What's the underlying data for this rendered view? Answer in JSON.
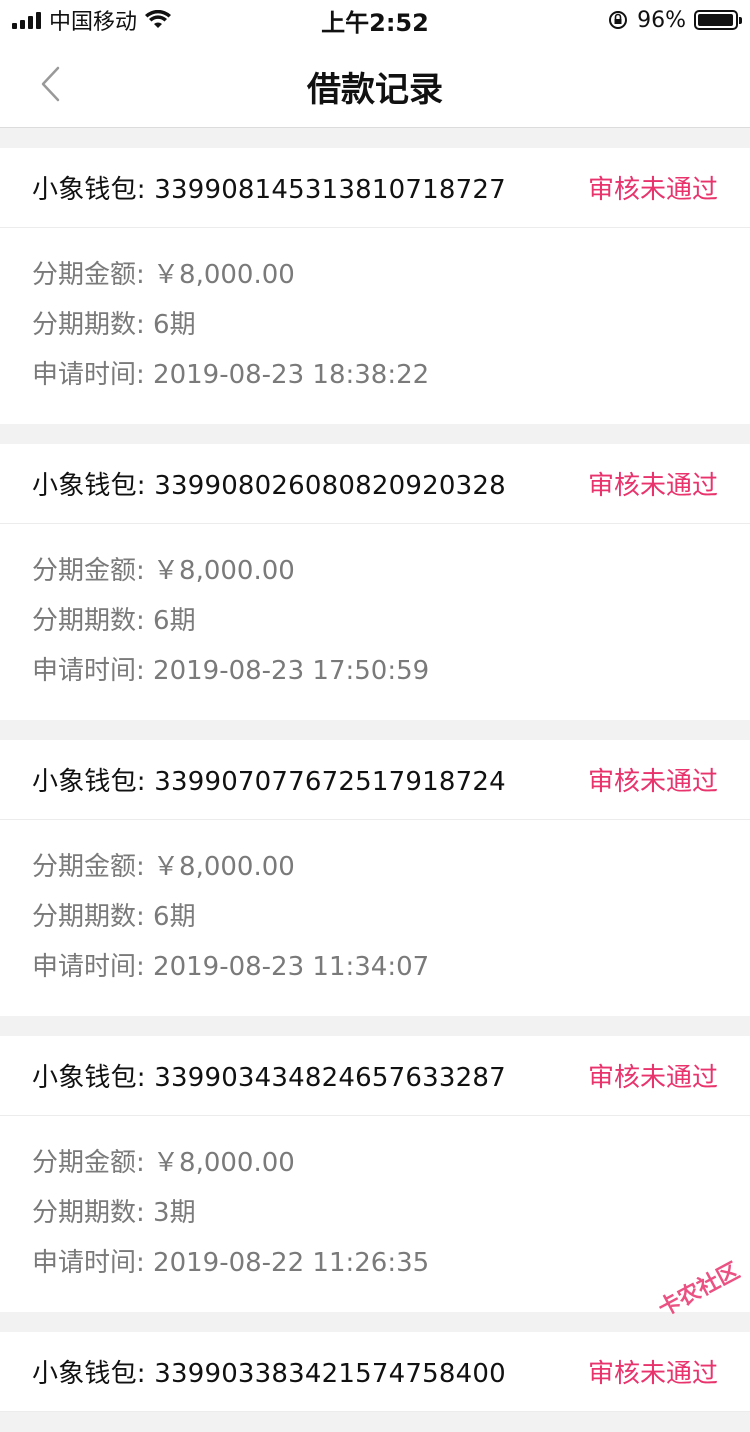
{
  "status_bar": {
    "carrier": "中国移动",
    "time": "上午2:52",
    "battery": "96%",
    "battery_level": 0.96
  },
  "nav": {
    "title": "借款记录",
    "back_icon": "chevron-left-icon"
  },
  "labels": {
    "amount": "分期金额: ",
    "periods": "分期期数: ",
    "applied": "申请时间: "
  },
  "records": [
    {
      "name": "小象钱包: 339908145313810718727",
      "status": "审核未通过",
      "amount": "￥8,000.00",
      "periods": "6期",
      "time": "2019-08-23 18:38:22"
    },
    {
      "name": "小象钱包: 339908026080820920328",
      "status": "审核未通过",
      "amount": "￥8,000.00",
      "periods": "6期",
      "time": "2019-08-23 17:50:59"
    },
    {
      "name": "小象钱包: 339907077672517918724",
      "status": "审核未通过",
      "amount": "￥8,000.00",
      "periods": "6期",
      "time": "2019-08-23 11:34:07"
    },
    {
      "name": "小象钱包: 339903434824657633287",
      "status": "审核未通过",
      "amount": "￥8,000.00",
      "periods": "3期",
      "time": "2019-08-22 11:26:35"
    },
    {
      "name": "小象钱包: 339903383421574758400",
      "status": "审核未通过"
    }
  ],
  "watermark": "卡农社区",
  "colors": {
    "status_red": "#e8336d",
    "muted_text": "#7a7a7a",
    "background": "#f2f2f2"
  }
}
